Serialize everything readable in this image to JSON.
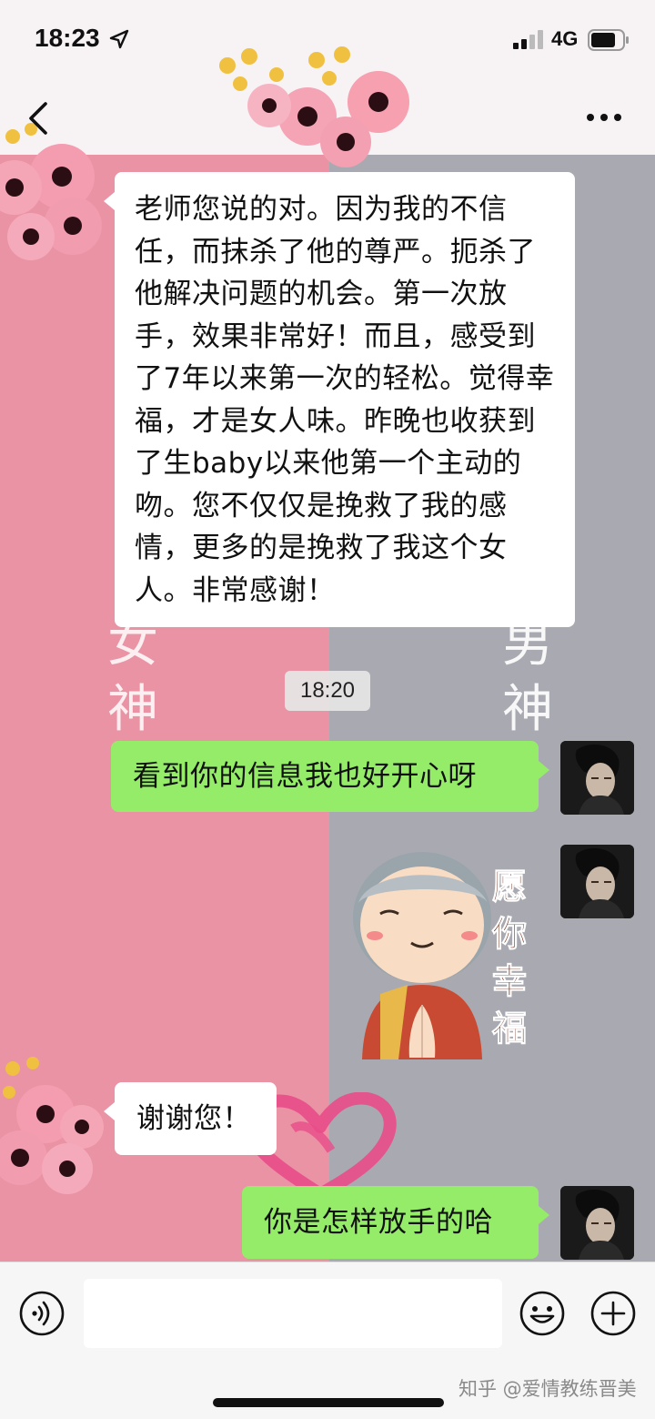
{
  "status_bar": {
    "time": "18:23",
    "network": "4G"
  },
  "nav_bar": {
    "back_icon": "chevron-left-icon",
    "more_icon": "more-horizontal-icon"
  },
  "wallpaper": {
    "left_word": "女神",
    "right_word": "男神",
    "left_color": "#ea93a4",
    "right_color": "#a9aab1"
  },
  "messages": [
    {
      "side": "left",
      "type": "text",
      "text": "老师您说的对。因为我的不信任，而抹杀了他的尊严。扼杀了他解决问题的机会。第一次放手，效果非常好！而且，感受到了7年以来第一次的轻松。觉得幸福，才是女人味。昨晚也收获到了生baby以来他第一个主动的吻。您不仅仅是挽救了我的感情，更多的是挽救了我这个女人。非常感谢！"
    },
    {
      "side": "right",
      "type": "text",
      "text": "看到你的信息我也好开心呀"
    },
    {
      "side": "right",
      "type": "sticker",
      "sticker_text": "愿你幸福"
    },
    {
      "side": "left",
      "type": "text",
      "text": "谢谢您！"
    },
    {
      "side": "right",
      "type": "text",
      "text": "你是怎样放手的哈"
    }
  ],
  "timestamp": "18:20",
  "input_bar": {
    "voice_icon": "voice-icon",
    "emoji_icon": "emoji-icon",
    "plus_icon": "plus-icon",
    "input_value": ""
  },
  "watermark": "知乎 @爱情教练晋美",
  "colors": {
    "green_bubble": "#95ec69",
    "white_bubble": "#ffffff"
  }
}
